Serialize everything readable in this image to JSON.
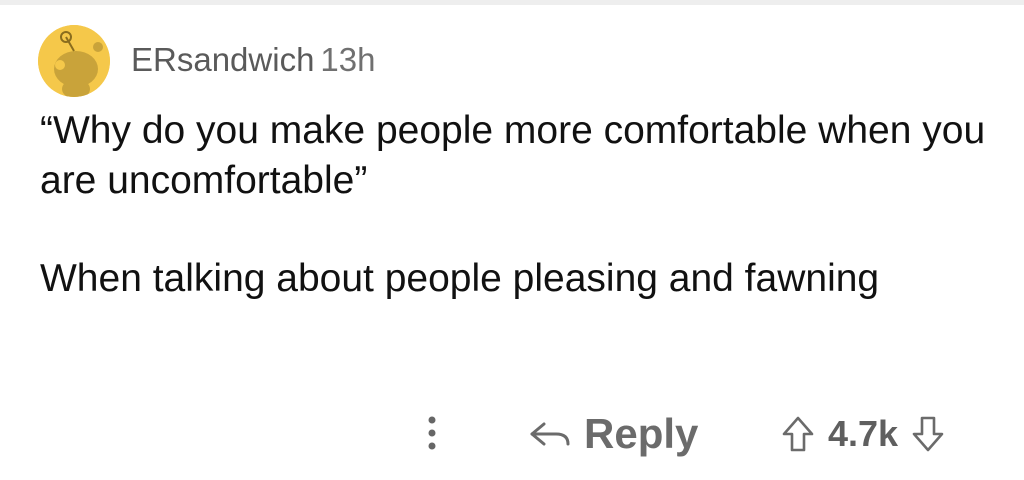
{
  "comment": {
    "author": "ERsandwich",
    "age": "13h",
    "paragraphs": [
      "“Why do you make people more comfortable when you are uncomfortable”",
      "When talking about people pleasing and fawning"
    ]
  },
  "actions": {
    "reply_label": "Reply",
    "score": "4.7k"
  },
  "icons": {
    "avatar": "reddit-snoo-avatar-icon",
    "more": "more-options-icon",
    "reply": "reply-arrow-icon",
    "upvote": "upvote-arrow-icon",
    "downvote": "downvote-arrow-icon"
  },
  "colors": {
    "avatar_bg": "#f5c84a",
    "secondary_text": "#6b6b6b"
  }
}
